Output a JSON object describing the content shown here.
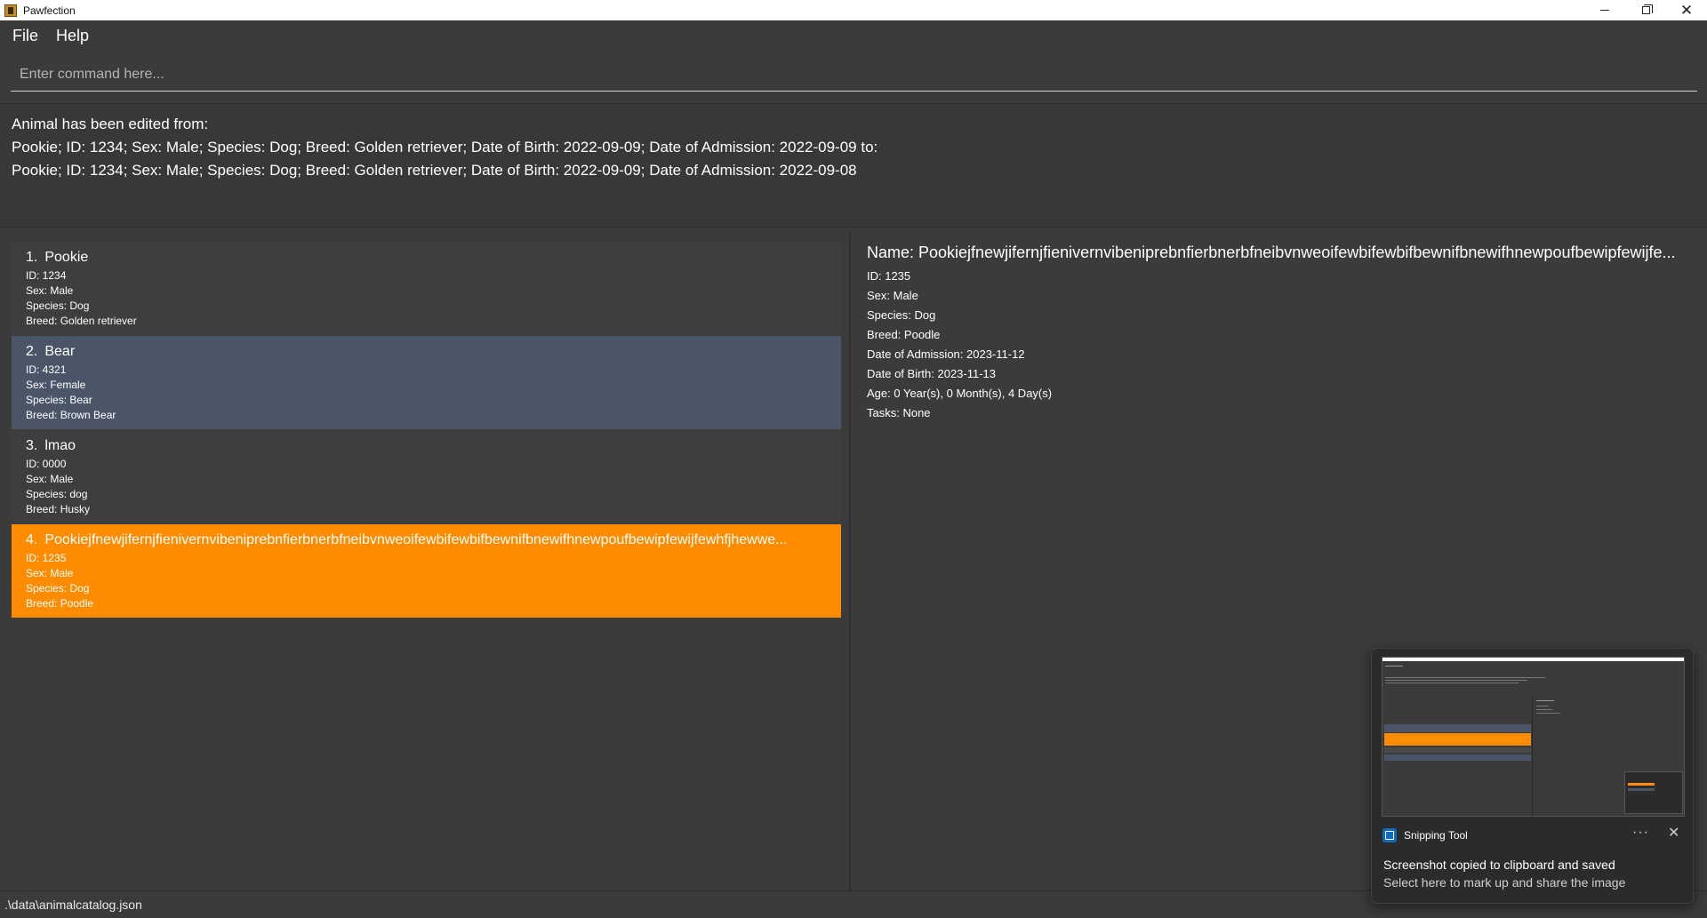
{
  "window": {
    "title": "Pawfection",
    "controls": {
      "minimize_icon": "minimize-icon",
      "maximize_icon": "restore-icon",
      "close_label": "✕"
    }
  },
  "menu": {
    "items": [
      "File",
      "Help"
    ]
  },
  "command": {
    "placeholder": "Enter command here..."
  },
  "result": {
    "lines": [
      "Animal has been edited from:",
      "Pookie; ID: 1234; Sex: Male; Species: Dog; Breed: Golden retriever; Date of Birth: 2022-09-09; Date of Admission: 2022-09-09 to:",
      "Pookie; ID: 1234; Sex: Male; Species: Dog; Breed: Golden retriever; Date of Birth: 2022-09-09; Date of Admission: 2022-09-08"
    ]
  },
  "animals": [
    {
      "index": "1.",
      "name": "Pookie",
      "id": "ID: 1234",
      "sex": "Sex: Male",
      "species": "Species: Dog",
      "breed": "Breed: Golden retriever",
      "state": "normal"
    },
    {
      "index": "2.",
      "name": "Bear",
      "id": "ID: 4321",
      "sex": "Sex: Female",
      "species": "Species: Bear",
      "breed": "Breed: Brown Bear",
      "state": "selected"
    },
    {
      "index": "3.",
      "name": "lmao",
      "id": "ID: 0000",
      "sex": "Sex: Male",
      "species": "Species: dog",
      "breed": "Breed: Husky",
      "state": "normal"
    },
    {
      "index": "4.",
      "name": "Pookiejfnewjifernjfienivernvibeniprebnfierbnerbfneibvnweoifewbifewbifbewnifbnewifhnewpoufbewipfewijfewhfjhewwe...",
      "id": "ID: 1235",
      "sex": "Sex: Male",
      "species": "Species: Dog",
      "breed": "Breed: Poodle",
      "state": "highlight"
    }
  ],
  "colors": {
    "selected": "#4a5568",
    "highlight": "#ff8c00",
    "background": "#3b3b3b"
  },
  "detail": {
    "name": "Name: Pookiejfnewjifernjfienivernvibeniprebnfierbnerbfneibvnweoifewbifewbifbewnifbnewifhnewpoufbewipfewijfe...",
    "fields": [
      "ID: 1235",
      "Sex: Male",
      "Species: Dog",
      "Breed: Poodle",
      "Date of Admission: 2023-11-12",
      "Date of Birth: 2023-11-13",
      "Age: 0 Year(s), 0 Month(s), 4 Day(s)",
      "Tasks: None"
    ]
  },
  "status": {
    "path": ".\\data\\animalcatalog.json"
  },
  "toast": {
    "app_name": "Snipping Tool",
    "more_label": "···",
    "close_label": "✕",
    "title": "Screenshot copied to clipboard and saved",
    "subtitle": "Select here to mark up and share the image"
  }
}
